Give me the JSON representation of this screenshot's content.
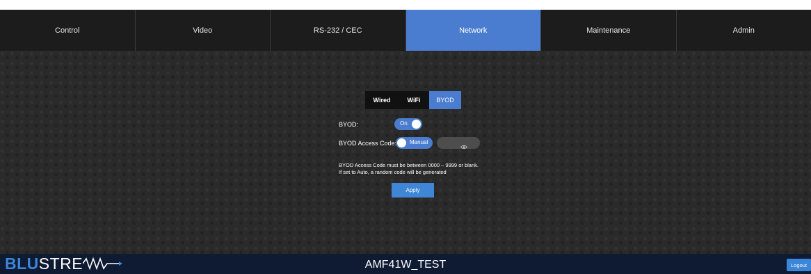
{
  "nav": {
    "tabs": [
      {
        "label": "Control"
      },
      {
        "label": "Video"
      },
      {
        "label": "RS-232 / CEC"
      },
      {
        "label": "Network"
      },
      {
        "label": "Maintenance"
      },
      {
        "label": "Admin"
      }
    ],
    "active": "Network"
  },
  "network": {
    "subtabs": [
      {
        "label": "Wired"
      },
      {
        "label": "WiFi"
      },
      {
        "label": "BYOD"
      }
    ],
    "active_subtab": "BYOD",
    "byod_label": "BYOD:",
    "byod_toggle": "On",
    "access_code_label": "BYOD Access Code:",
    "access_code_mode": "Manual",
    "info_line1": "BYOD Access Code must be between 0000 – 9999 or blank.",
    "info_line2": "If set to Auto, a random code will be generated",
    "apply_label": "Apply"
  },
  "footer": {
    "logo_blu": "BLU",
    "logo_stream": "STRE",
    "device_name": "AMF41W_TEST",
    "logout_label": "Logout"
  },
  "colors": {
    "accent": "#4a7dcf",
    "nav_bg": "#1c1c1c",
    "main_bg": "#2a2a2a",
    "footer_bg": "#0f1a33",
    "logo_blue": "#3b86d8"
  },
  "icons": {
    "password_field": "eye-icon",
    "logo_wave": "wave-arrow-icon"
  }
}
